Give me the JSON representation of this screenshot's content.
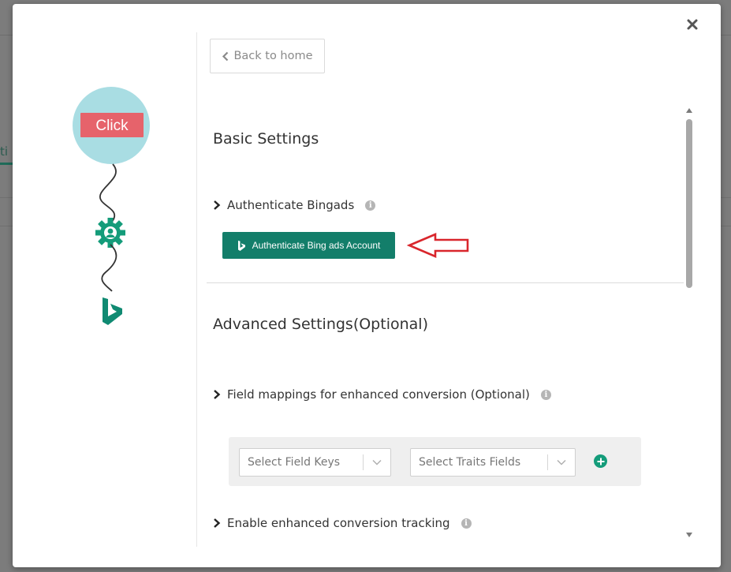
{
  "background": {
    "tab_fragment": "ti"
  },
  "modal": {
    "close_icon": "close-icon",
    "illustration": {
      "click_label": "Click",
      "gear_icon": "gear-person-icon",
      "brand_icon": "bing-logo-icon"
    },
    "back_button_label": "Back to home",
    "basic_settings": {
      "title": "Basic Settings",
      "authenticate_label": "Authenticate Bingads",
      "auth_button_label": "Authenticate Bing ads Account"
    },
    "advanced_settings": {
      "title": "Advanced Settings(Optional)",
      "field_mappings_label": "Field mappings for enhanced conversion (Optional)",
      "select_field_keys_placeholder": "Select Field Keys",
      "select_traits_placeholder": "Select Traits Fields",
      "enable_tracking_label": "Enable enhanced conversion tracking"
    },
    "annotation_color": "#d9262c",
    "accent_color": "#137e6a"
  }
}
